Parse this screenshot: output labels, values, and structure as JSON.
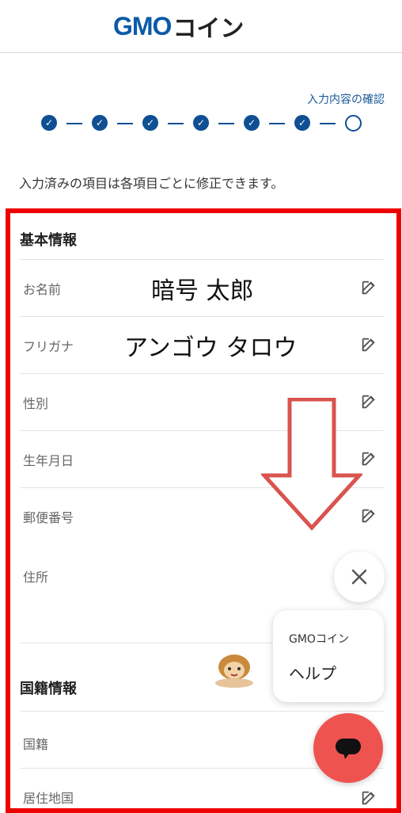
{
  "header": {
    "logo_latin": "GMO",
    "logo_kana": "コイン"
  },
  "progress": {
    "label": "入力内容の確認",
    "completed_steps": 6,
    "total_steps": 7
  },
  "intro_text": "入力済みの項目は各項目ごとに修正できます。",
  "basic_info": {
    "title": "基本情報",
    "rows": [
      {
        "label": "お名前",
        "value": "暗号 太郎"
      },
      {
        "label": "フリガナ",
        "value": "アンゴウ タロウ"
      },
      {
        "label": "性別",
        "value": ""
      },
      {
        "label": "生年月日",
        "value": ""
      },
      {
        "label": "郵便番号",
        "value": ""
      },
      {
        "label": "住所",
        "value": ""
      }
    ]
  },
  "nationality_info": {
    "title": "国籍情報",
    "rows": [
      {
        "label": "国籍",
        "value": ""
      },
      {
        "label": "居住地国",
        "value": ""
      }
    ]
  },
  "help_widget": {
    "brand": "GMOコイン",
    "label": "ヘルプ"
  },
  "icons": {
    "edit": "edit-icon",
    "close": "close-icon",
    "chat": "chat-bubble-icon",
    "arrow": "down-arrow-icon"
  },
  "colors": {
    "brand_blue": "#0f4f93",
    "frame_red": "#ee0000",
    "chat_red": "#ef5350"
  }
}
